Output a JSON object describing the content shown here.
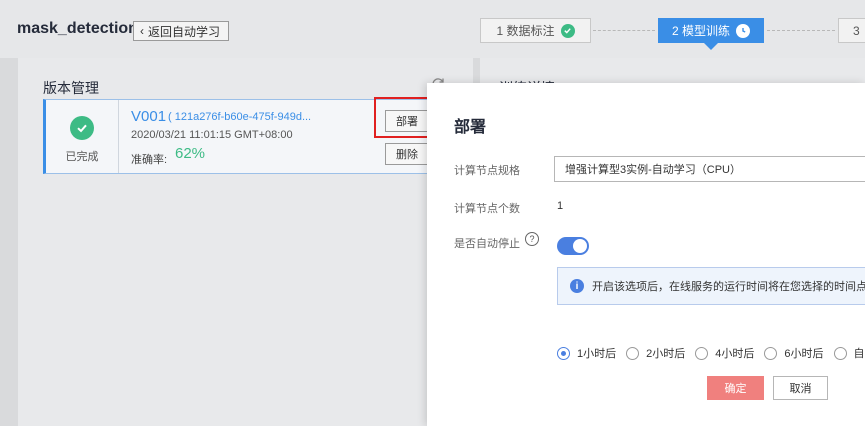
{
  "header": {
    "app_title": "mask_detection",
    "back_label": "返回自动学习",
    "steps": [
      {
        "label": "1 数据标注",
        "state": "done"
      },
      {
        "label": "2 模型训练",
        "state": "active"
      },
      {
        "label": "3",
        "state": "pending"
      }
    ]
  },
  "version_panel": {
    "title": "版本管理",
    "card": {
      "status": "已完成",
      "version": "V001",
      "id": "( 121a276f-b60e-475f-949d...",
      "time": "2020/03/21 11:01:15 GMT+08:00",
      "accuracy_label": "准确率:",
      "accuracy_value": "62%",
      "deploy_label": "部署",
      "delete_label": "删除"
    }
  },
  "detail_panel": {
    "title": "训练详情"
  },
  "dialog": {
    "title": "部署",
    "spec_label": "计算节点规格",
    "spec_value": "增强计算型3实例-自动学习（CPU）",
    "count_label": "计算节点个数",
    "count_value": "1",
    "autostop_label": "是否自动停止",
    "autostop_on": true,
    "info_text": "开启该选项后，在线服务的运行时间将在您选择的时间点后，",
    "stop_options": [
      "1小时后",
      "2小时后",
      "4小时后",
      "6小时后",
      "自"
    ],
    "stop_selected": "1小时后",
    "confirm_label": "确定",
    "cancel_label": "取消"
  },
  "colors": {
    "accent": "#3a8ee6",
    "success": "#3dbb85",
    "highlight": "#e02020",
    "confirm": "#f0807e",
    "toggle": "#4a7fe0"
  }
}
